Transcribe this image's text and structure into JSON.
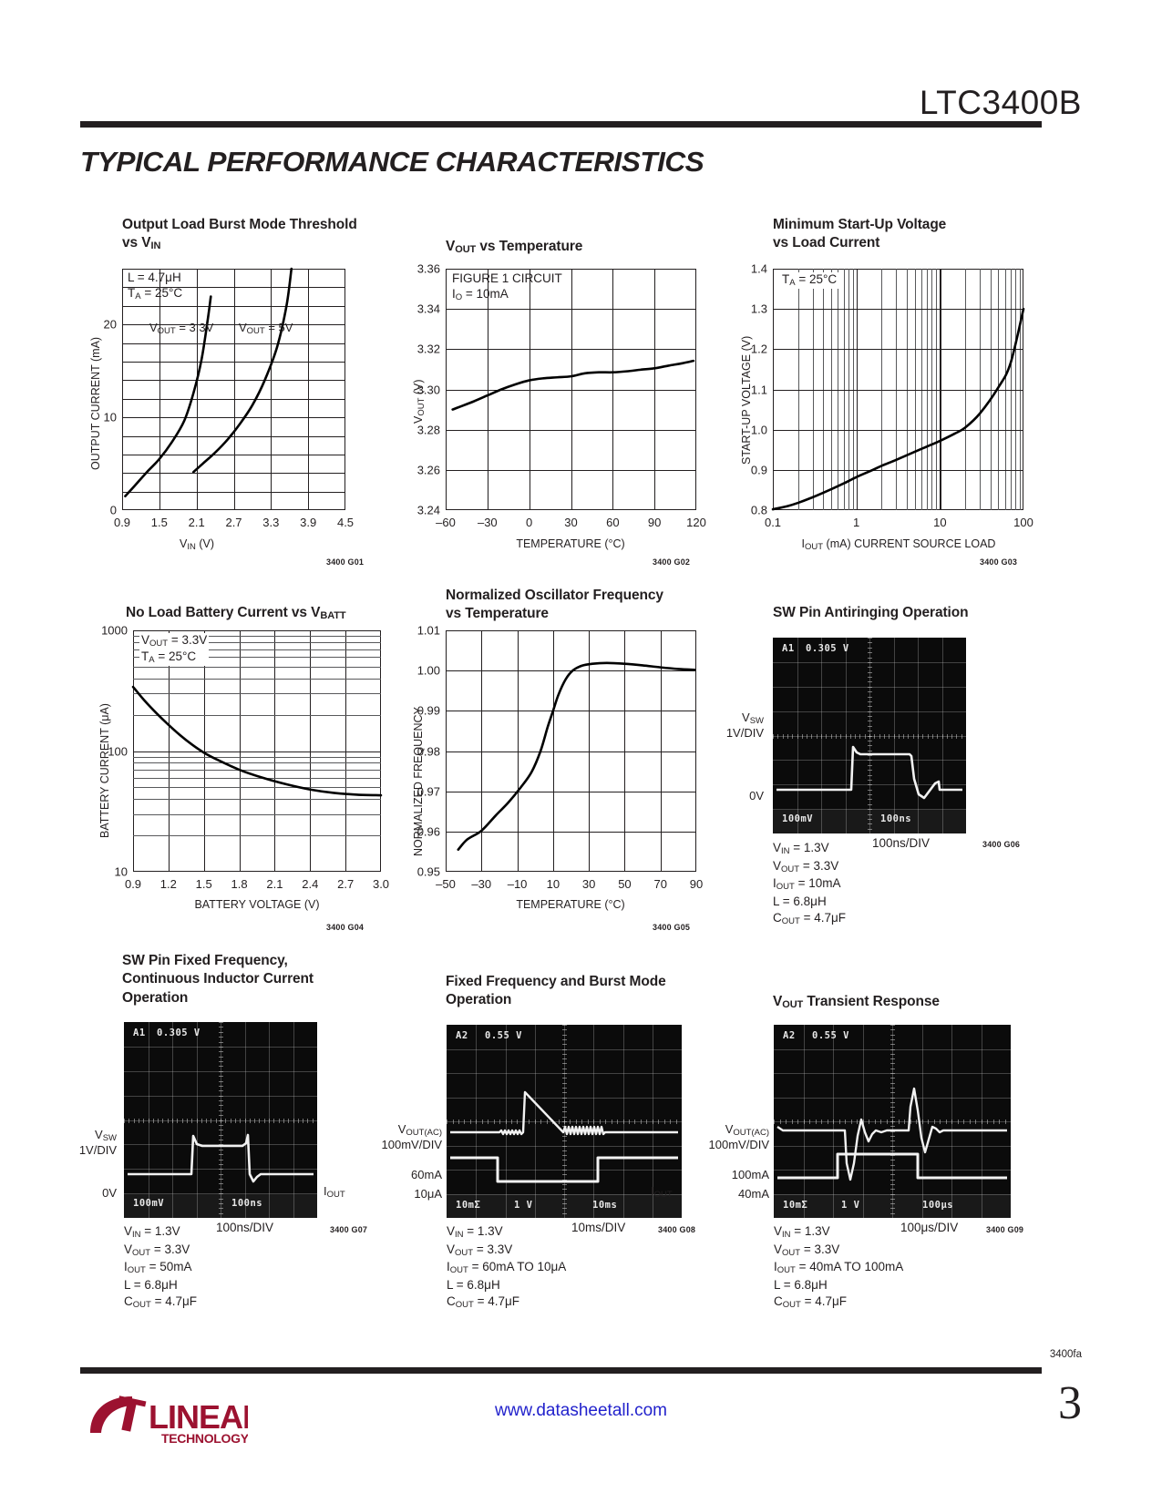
{
  "header": {
    "part_number": "LTC3400B",
    "section_title": "TYPICAL PERFORMANCE CHARACTERISTICS"
  },
  "footer": {
    "revision": "3400fa",
    "website": "www.datasheetall.com",
    "page_number": "3",
    "logo_line1": "LINEAR",
    "logo_line2": "TECHNOLOGY"
  },
  "charts": [
    {
      "id": "g01",
      "graph_number": "3400 G01",
      "title_line1": "Output Load Burst Mode Threshold",
      "title_line2_prefix": "vs V",
      "title_line2_sub": "IN",
      "conditions": [
        "L = 4.7μH",
        "Tₐ = 25°C"
      ],
      "curve_labels": [
        "V",
        "OUT",
        " = 3.3V",
        "V",
        "OUT",
        " = 5V"
      ],
      "label_33": "V_OUT = 3.3V",
      "label_5": "V_OUT = 5V"
    },
    {
      "id": "g02",
      "graph_number": "3400 G02",
      "title_line1_prefix": "V",
      "title_line1_sub": "OUT",
      "title_line1_suffix": " vs Temperature",
      "conditions": [
        "FIGURE 1 CIRCUIT",
        "Iₒ = 10mA"
      ]
    },
    {
      "id": "g03",
      "graph_number": "3400 G03",
      "title_line1": "Minimum Start-Up Voltage",
      "title_line2": "vs Load Current",
      "conditions": [
        "Tₐ = 25°C"
      ]
    },
    {
      "id": "g04",
      "graph_number": "3400 G04",
      "title_prefix": "No Load Battery Current vs V",
      "title_sub": "BATT",
      "conditions": [
        "V_OUT = 3.3V",
        "Tₐ = 25°C"
      ]
    },
    {
      "id": "g05",
      "graph_number": "3400 G05",
      "title_line1": "Normalized Oscillator Frequency",
      "title_line2": "vs Temperature",
      "conditions": []
    }
  ],
  "chart_data": [
    {
      "id": "g01",
      "type": "line",
      "title": "Output Load Burst Mode Threshold vs VIN",
      "xlabel": "VIN (V)",
      "ylabel": "OUTPUT CURRENT (mA)",
      "xlim": [
        0.9,
        4.5
      ],
      "ylim": [
        0,
        26
      ],
      "xticks": [
        "0.9",
        "1.5",
        "2.1",
        "2.7",
        "3.3",
        "3.9",
        "4.5"
      ],
      "yticks": [
        "0",
        "10",
        "20"
      ],
      "grid": true,
      "annotations": [
        "L = 4.7uH",
        "TA = 25C"
      ],
      "series": [
        {
          "name": "VOUT = 3.3V",
          "x": [
            0.95,
            1.1,
            1.3,
            1.5,
            1.7,
            1.9,
            2.05,
            2.18,
            2.28,
            2.33
          ],
          "y": [
            1.5,
            2.6,
            4.1,
            5.5,
            7.3,
            9.6,
            12.6,
            16.2,
            20.5,
            23.0
          ]
        },
        {
          "name": "VOUT = 5V",
          "x": [
            2.05,
            2.2,
            2.4,
            2.6,
            2.8,
            3.0,
            3.2,
            3.4,
            3.55,
            3.63
          ],
          "y": [
            4.1,
            5.0,
            6.2,
            7.6,
            9.3,
            11.3,
            14.0,
            17.6,
            22.0,
            26.0
          ]
        }
      ]
    },
    {
      "id": "g02",
      "type": "line",
      "title": "VOUT vs Temperature",
      "xlabel": "TEMPERATURE (°C)",
      "ylabel": "VOUT (V)",
      "xlim": [
        -60,
        120
      ],
      "ylim": [
        3.24,
        3.36
      ],
      "xticks": [
        "–60",
        "–30",
        "0",
        "30",
        "60",
        "90",
        "120"
      ],
      "yticks": [
        "3.24",
        "3.26",
        "3.28",
        "3.30",
        "3.32",
        "3.34",
        "3.36"
      ],
      "grid": true,
      "annotations": [
        "FIGURE 1 CIRCUIT",
        "IO = 10mA"
      ],
      "series": [
        {
          "name": "VOUT",
          "x": [
            -55,
            -40,
            -30,
            -20,
            -10,
            0,
            10,
            20,
            30,
            40,
            50,
            60,
            70,
            80,
            90,
            100,
            110,
            118
          ],
          "y": [
            3.29,
            3.294,
            3.297,
            3.3,
            3.3025,
            3.3045,
            3.3055,
            3.306,
            3.3065,
            3.308,
            3.3085,
            3.3085,
            3.309,
            3.3098,
            3.3105,
            3.3118,
            3.313,
            3.3142
          ]
        }
      ]
    },
    {
      "id": "g03",
      "type": "line",
      "title": "Minimum Start-Up Voltage vs Load Current",
      "xlabel": "IOUT (mA) CURRENT SOURCE LOAD",
      "ylabel": "START-UP VOLTAGE (V)",
      "xscale": "log",
      "xlim": [
        0.1,
        100
      ],
      "ylim": [
        0.8,
        1.4
      ],
      "xticks": [
        "0.1",
        "1",
        "10",
        "100"
      ],
      "yticks": [
        "0.8",
        "0.9",
        "1.0",
        "1.1",
        "1.2",
        "1.3",
        "1.4"
      ],
      "grid": true,
      "annotations": [
        "TA = 25C"
      ],
      "series": [
        {
          "name": "start-up voltage",
          "x": [
            0.1,
            0.15,
            0.2,
            0.3,
            0.5,
            0.7,
            1,
            1.5,
            2,
            3,
            5,
            7,
            10,
            15,
            20,
            30,
            50,
            70,
            100
          ],
          "y": [
            0.802,
            0.81,
            0.818,
            0.832,
            0.852,
            0.866,
            0.882,
            0.898,
            0.91,
            0.925,
            0.945,
            0.958,
            0.972,
            0.99,
            1.005,
            1.04,
            1.105,
            1.165,
            1.3
          ]
        }
      ]
    },
    {
      "id": "g04",
      "type": "line",
      "title": "No Load Battery Current vs VBATT",
      "xlabel": "BATTERY VOLTAGE (V)",
      "ylabel": "BATTERY CURRENT (μA)",
      "yscale": "log",
      "xlim": [
        0.9,
        3.0
      ],
      "ylim": [
        10,
        1000
      ],
      "xticks": [
        "0.9",
        "1.2",
        "1.5",
        "1.8",
        "2.1",
        "2.4",
        "2.7",
        "3.0"
      ],
      "yticks": [
        "10",
        "100",
        "1000"
      ],
      "grid": true,
      "annotations": [
        "VOUT = 3.3V",
        "TA = 25C"
      ],
      "series": [
        {
          "name": "battery current",
          "x": [
            0.9,
            1.0,
            1.1,
            1.2,
            1.3,
            1.4,
            1.5,
            1.6,
            1.8,
            2.0,
            2.2,
            2.4,
            2.6,
            2.8,
            3.0
          ],
          "y": [
            340,
            260,
            205,
            165,
            135,
            113,
            97,
            86,
            70,
            60,
            53,
            48,
            45,
            43.5,
            43
          ]
        }
      ]
    },
    {
      "id": "g05",
      "type": "line",
      "title": "Normalized Oscillator Frequency vs Temperature",
      "xlabel": "TEMPERATURE (°C)",
      "ylabel": "NORMALIZED FREQUENCY",
      "xlim": [
        -50,
        90
      ],
      "ylim": [
        0.95,
        1.01
      ],
      "xticks": [
        "–50",
        "–30",
        "–10",
        "10",
        "30",
        "50",
        "70",
        "90"
      ],
      "yticks": [
        "0.95",
        "0.96",
        "0.97",
        "0.98",
        "0.99",
        "1.00",
        "1.01"
      ],
      "grid": true,
      "annotations": [],
      "series": [
        {
          "name": "normalized frequency",
          "x": [
            -43,
            -38,
            -30,
            -22,
            -15,
            -8,
            -2,
            3,
            7,
            10,
            13,
            17,
            21,
            26,
            32,
            40,
            50,
            60,
            70,
            80,
            89
          ],
          "y": [
            0.9555,
            0.958,
            0.9602,
            0.964,
            0.9672,
            0.971,
            0.9748,
            0.98,
            0.986,
            0.99,
            0.994,
            0.9978,
            1.0,
            1.0012,
            1.0017,
            1.0019,
            1.0017,
            1.0013,
            1.0008,
            1.0004,
            1.0002
          ]
        }
      ]
    }
  ],
  "scopes": [
    {
      "id": "g06",
      "graph_number": "3400 G06",
      "title": "SW Pin Antiringing Operation",
      "osd_channel": "A1",
      "osd_value": "0.305 V",
      "osd_left": "100mV",
      "osd_right": "100ns",
      "trace_labels": [
        {
          "line1": "V",
          "sub": "SW",
          "line2": "1V/DIV"
        }
      ],
      "zero_label": "0V",
      "timebase": "100ns/DIV",
      "conditions": [
        {
          "sym": "V",
          "sub": "IN",
          "val": " = 1.3V"
        },
        {
          "sym": "V",
          "sub": "OUT",
          "val": " = 3.3V"
        },
        {
          "sym": "I",
          "sub": "OUT",
          "val": " = 10mA"
        },
        {
          "sym": "L",
          "sub": "",
          "val": " = 6.8μH"
        },
        {
          "sym": "C",
          "sub": "OUT",
          "val": " = 4.7μF"
        }
      ]
    },
    {
      "id": "g07",
      "graph_number": "3400 G07",
      "title_line1": "SW Pin Fixed Frequency,",
      "title_line2": "Continuous Inductor Current",
      "title_line3": "Operation",
      "osd_channel": "A1",
      "osd_value": "0.305 V",
      "osd_left": "100mV",
      "osd_right": "100ns",
      "trace_label_sym": "V",
      "trace_label_sub": "SW",
      "trace_label_scale": "1V/DIV",
      "zero_label": "0V",
      "timebase": "100ns/DIV",
      "conditions": [
        {
          "sym": "V",
          "sub": "IN",
          "val": " = 1.3V"
        },
        {
          "sym": "V",
          "sub": "OUT",
          "val": " = 3.3V"
        },
        {
          "sym": "I",
          "sub": "OUT",
          "val": " = 50mA"
        },
        {
          "sym": "L",
          "sub": "",
          "val": " = 6.8μH"
        },
        {
          "sym": "C",
          "sub": "OUT",
          "val": " = 4.7μF"
        }
      ]
    },
    {
      "id": "g08",
      "graph_number": "3400 G08",
      "title_line1": "Fixed Frequency and Burst Mode",
      "title_line2": "Operation",
      "osd_channel": "A2",
      "osd_value": "0.55 V",
      "osd_left": "10mƩ",
      "osd_mid": "1 V",
      "osd_right": "10ms",
      "trace_label_sym": "V",
      "trace_label_sub": "OUT(AC)",
      "trace_label_scale": "100mV/DIV",
      "iout_label_sym": "I",
      "iout_label_sub": "OUT",
      "iout_hi": "60mA",
      "iout_lo": "10μA",
      "timebase": "10ms/DIV",
      "conditions": [
        {
          "sym": "V",
          "sub": "IN",
          "val": " = 1.3V"
        },
        {
          "sym": "V",
          "sub": "OUT",
          "val": " = 3.3V"
        },
        {
          "sym": "I",
          "sub": "OUT",
          "val": " = 60mA TO 10μA"
        },
        {
          "sym": "L",
          "sub": "",
          "val": " = 6.8μH"
        },
        {
          "sym": "C",
          "sub": "OUT",
          "val": " = 4.7μF"
        }
      ]
    },
    {
      "id": "g09",
      "graph_number": "3400 G09",
      "title_prefix": "V",
      "title_sub": "OUT",
      "title_suffix": " Transient Response",
      "osd_channel": "A2",
      "osd_value": "0.55 V",
      "osd_left": "10mƩ",
      "osd_mid": "1 V",
      "osd_right": "100μs",
      "trace_label_sym": "V",
      "trace_label_sub": "OUT(AC)",
      "trace_label_scale": "100mV/DIV",
      "iout_label_sym": "I",
      "iout_label_sub": "OUT",
      "iout_hi": "100mA",
      "iout_lo": "40mA",
      "timebase": "100μs/DIV",
      "conditions": [
        {
          "sym": "V",
          "sub": "IN",
          "val": " = 1.3V"
        },
        {
          "sym": "V",
          "sub": "OUT",
          "val": " = 3.3V"
        },
        {
          "sym": "I",
          "sub": "OUT",
          "val": " = 40mA TO 100mA"
        },
        {
          "sym": "L",
          "sub": "",
          "val": " = 6.8μH"
        },
        {
          "sym": "C",
          "sub": "OUT",
          "val": " = 4.7μF"
        }
      ]
    }
  ],
  "axis_text": {
    "g01_x": "V",
    "g01_x_sub": "IN",
    "g01_x_suffix": " (V)",
    "g01_y": "OUTPUT CURRENT (mA)",
    "g02_x": "TEMPERATURE (°C)",
    "g02_y_prefix": "V",
    "g02_y_sub": "OUT",
    "g02_y_suffix": " (V)",
    "g03_x_prefix": "I",
    "g03_x_sub": "OUT",
    "g03_x_suffix": " (mA) CURRENT SOURCE LOAD",
    "g03_y": "START-UP VOLTAGE (V)",
    "g04_x": "BATTERY VOLTAGE (V)",
    "g04_y": "BATTERY CURRENT (μA)",
    "g05_x": "TEMPERATURE (°C)",
    "g05_y": "NORMALIZED FREQUENCY"
  }
}
